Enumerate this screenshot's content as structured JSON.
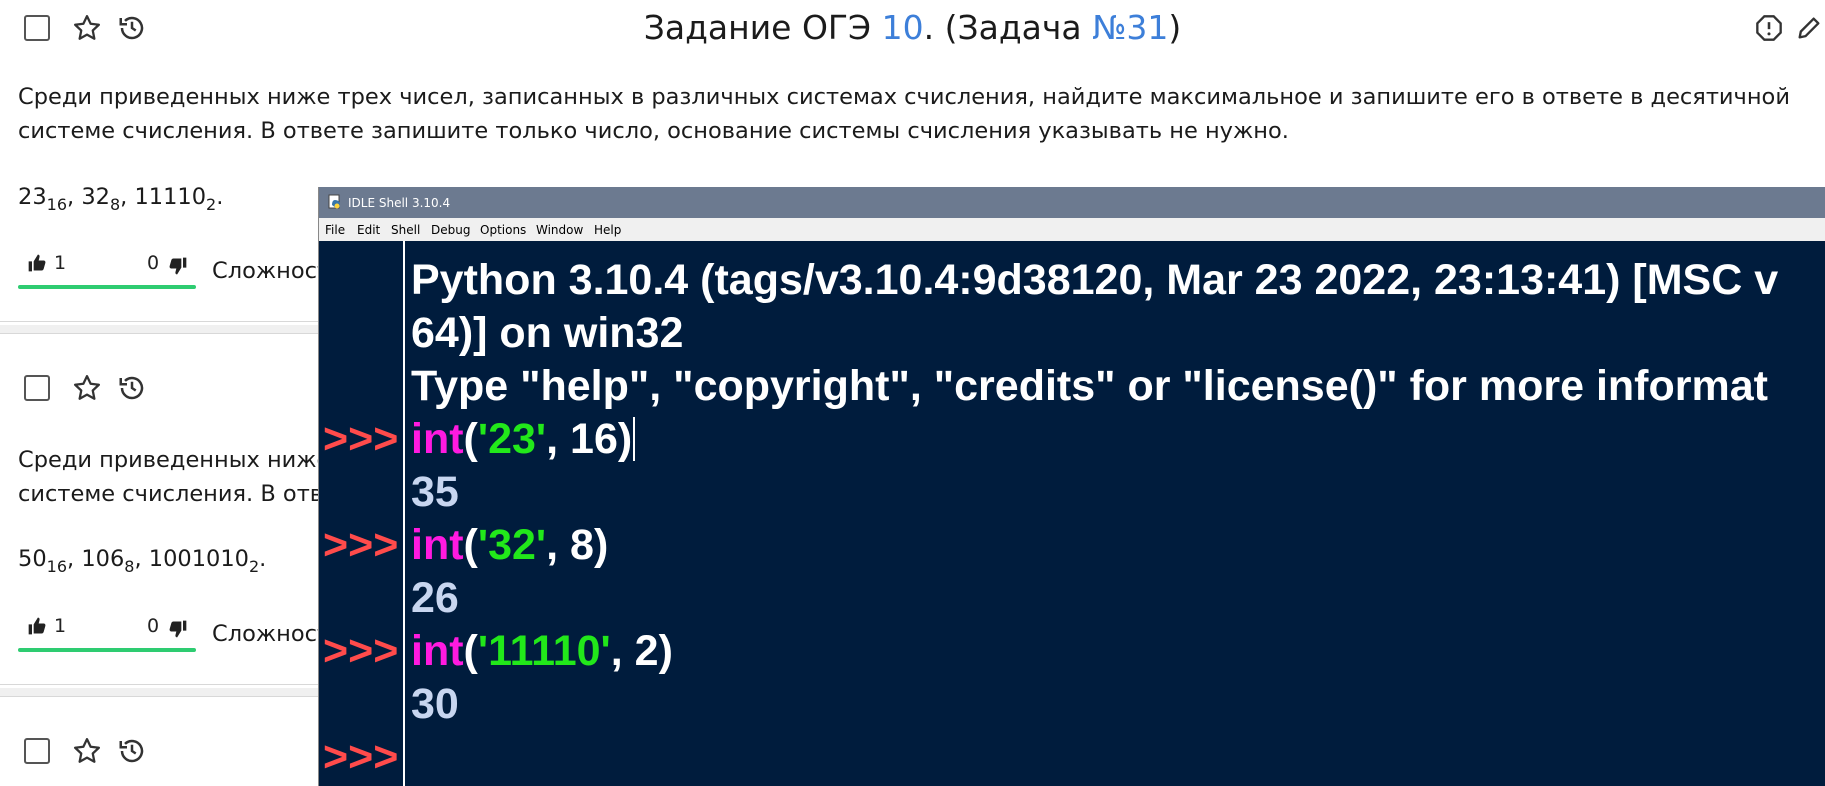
{
  "header": {
    "title_prefix": "Задание ОГЭ ",
    "task_number": "10",
    "title_mid": ". (Задача ",
    "problem_number": "№31",
    "title_suffix": ")"
  },
  "problems": [
    {
      "text_line1": "Среди приведенных ниже трех чисел, записанных в различных системах счисления, найдите максимальное и запишите его в ответе в десятичной",
      "text_line2": "системе счисления. В ответе запишите только число, основание системы счисления указывать не нужно.",
      "numbers": [
        {
          "value": "23",
          "base": "16",
          "sep": ", "
        },
        {
          "value": "32",
          "base": "8",
          "sep": ", "
        },
        {
          "value": "11110",
          "base": "2",
          "sep": "."
        }
      ],
      "likes": "1",
      "dislikes": "0",
      "difficulty_label": "Сложност"
    },
    {
      "text_line1": "Среди приведенных ниже",
      "text_line2": "системе счисления. В отв",
      "numbers": [
        {
          "value": "50",
          "base": "16",
          "sep": ", "
        },
        {
          "value": "106",
          "base": "8",
          "sep": ", "
        },
        {
          "value": "1001010",
          "base": "2",
          "sep": "."
        }
      ],
      "likes": "1",
      "dislikes": "0",
      "difficulty_label": "Сложност"
    }
  ],
  "idle": {
    "window_title": "IDLE Shell 3.10.4",
    "menu": [
      "File",
      "Edit",
      "Shell",
      "Debug",
      "Options",
      "Window",
      "Help"
    ],
    "banner_line1": "Python 3.10.4 (tags/v3.10.4:9d38120, Mar 23 2022, 23:13:41) [MSC v",
    "banner_line2": "64)] on win32",
    "banner_line3": "Type \"help\", \"copyright\", \"credits\" or \"license()\" for more informat",
    "prompt": ">>>",
    "commands": [
      {
        "func": "int",
        "open": "(",
        "arg": "'23'",
        "rest": ", 16)",
        "output": "35"
      },
      {
        "func": "int",
        "open": "(",
        "arg": "'32'",
        "rest": ", 8)",
        "output": "26"
      },
      {
        "func": "int",
        "open": "(",
        "arg": "'11110'",
        "rest": ", 2)",
        "output": "30"
      }
    ]
  },
  "colors": {
    "accent_link": "#3d7fd9",
    "vote_bar": "#2ecc71",
    "idle_bg": "#001c3d",
    "prompt": "#ff4b4b",
    "keyword": "#ff1ae0",
    "string": "#22e81a"
  },
  "icons": [
    "checkbox",
    "star-icon",
    "history-icon",
    "report-icon",
    "edit-icon",
    "thumbs-up-icon",
    "thumbs-down-icon",
    "idle-app-icon"
  ]
}
